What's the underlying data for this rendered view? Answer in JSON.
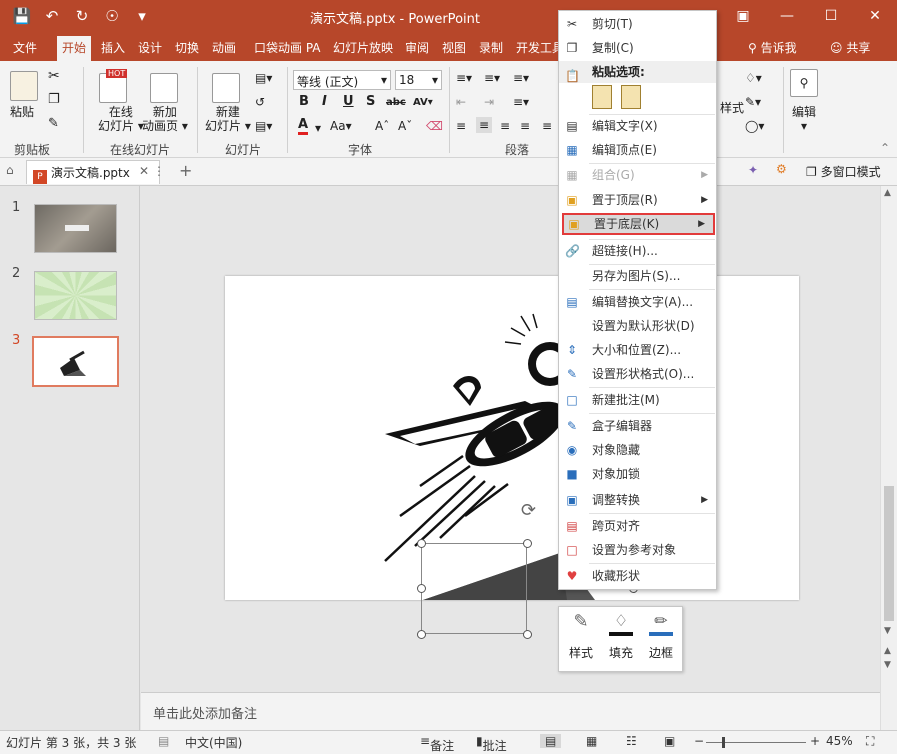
{
  "window": {
    "title": "演示文稿.pptx  -  PowerPoint",
    "accent": "#b7472a"
  },
  "ribbon_tabs": [
    "文件",
    "开始",
    "插入",
    "设计",
    "切换",
    "动画",
    "口袋动画 PA",
    "幻灯片放映",
    "审阅",
    "视图",
    "录制",
    "开发工具"
  ],
  "tell_me": "告诉我",
  "share": "共享",
  "ribbon": {
    "paste": "粘贴",
    "clipboard_group": "剪贴板",
    "online_slides_1": "在线",
    "online_slides_2": "幻灯片",
    "new_anim_1": "新加",
    "new_anim_2": "动画页",
    "online_group": "在线幻灯片",
    "new_slide_1": "新建",
    "new_slide_2": "幻灯片",
    "slides_group": "幻灯片",
    "font_name": "等线 (正文)",
    "font_size": "18",
    "font_group": "字体",
    "para_group": "段落",
    "style_label": "样式",
    "edit_label": "编辑",
    "hot_badge": "HOT"
  },
  "doc_tab": {
    "name": "演示文稿.pptx",
    "multi_window": "多窗口模式"
  },
  "slides": [
    {
      "num": "1"
    },
    {
      "num": "2"
    },
    {
      "num": "3"
    }
  ],
  "context_menu": {
    "cut": "剪切(T)",
    "copy": "复制(C)",
    "paste_options": "粘贴选项:",
    "edit_text": "编辑文字(X)",
    "edit_points": "编辑顶点(E)",
    "group": "组合(G)",
    "bring_front": "置于顶层(R)",
    "send_back": "置于底层(K)",
    "hyperlink": "超链接(H)...",
    "save_as_picture": "另存为图片(S)...",
    "edit_alt_text": "编辑替换文字(A)...",
    "set_default_shape": "设置为默认形状(D)",
    "size_position": "大小和位置(Z)...",
    "format_shape": "设置形状格式(O)...",
    "new_comment": "新建批注(M)",
    "box_editor": "盒子编辑器",
    "hide_object": "对象隐藏",
    "lock_object": "对象加锁",
    "adjust_convert": "调整转换",
    "cross_page_align": "跨页对齐",
    "set_reference": "设置为参考对象",
    "favorite_shape": "收藏形状"
  },
  "mini_toolbar": {
    "style": "样式",
    "fill": "填充",
    "border": "边框"
  },
  "notes_placeholder": "单击此处添加备注",
  "status": {
    "slide_count": "幻灯片 第 3 张，共 3 张",
    "language": "中文(中国)",
    "notes": "备注",
    "comments": "批注",
    "zoom": "45%"
  }
}
